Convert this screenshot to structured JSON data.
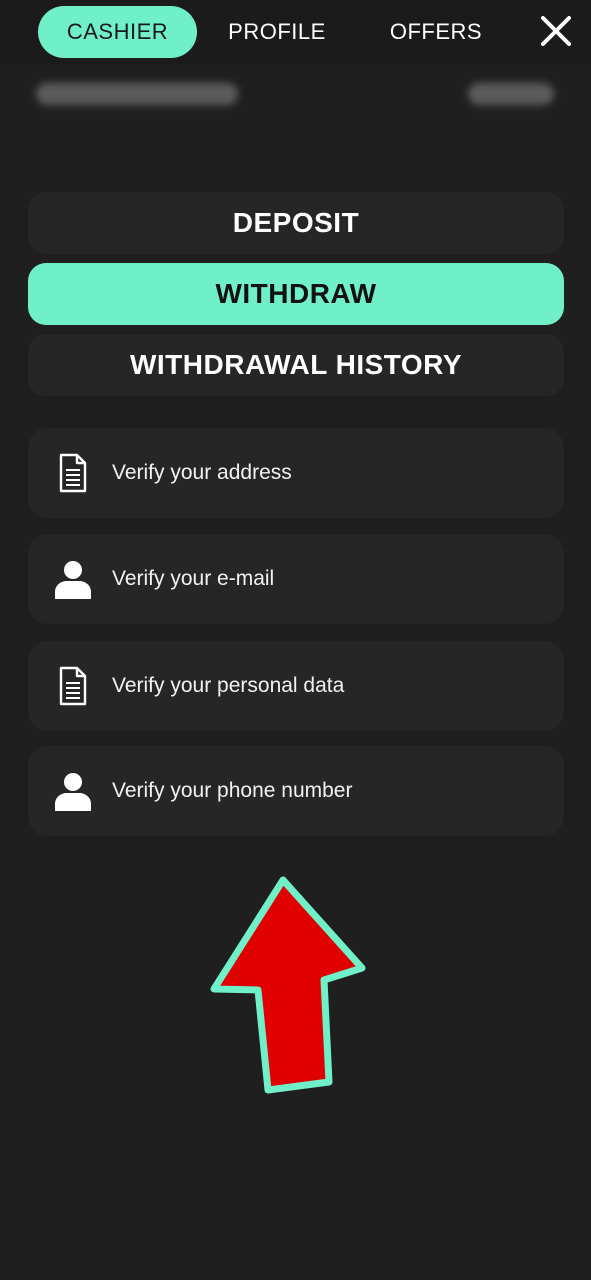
{
  "topnav": {
    "tabs": [
      {
        "label": "CASHIER",
        "active": true
      },
      {
        "label": "PROFILE",
        "active": false
      },
      {
        "label": "OFFERS",
        "active": false
      }
    ],
    "close_icon": "close-icon"
  },
  "sections": {
    "deposit": "DEPOSIT",
    "withdraw": "WITHDRAW",
    "history": "WITHDRAWAL HISTORY",
    "active": "withdraw"
  },
  "verify": [
    {
      "label": "Verify your address",
      "icon": "document-icon"
    },
    {
      "label": "Verify your e-mail",
      "icon": "user-icon"
    },
    {
      "label": "Verify your personal data",
      "icon": "document-icon"
    },
    {
      "label": "Verify your phone number",
      "icon": "user-icon"
    }
  ],
  "colors": {
    "accent": "#6ff0c8",
    "background": "#1f1f1f",
    "card": "#262626",
    "arrow_fill": "#e00000",
    "arrow_outline": "#6ff0c8"
  }
}
